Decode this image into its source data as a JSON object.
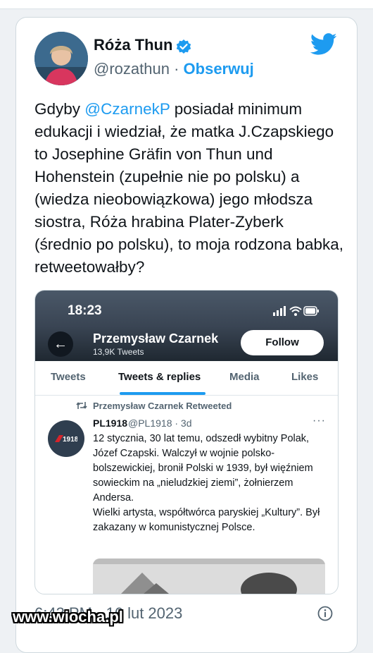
{
  "tweet": {
    "author_name": "Róża Thun",
    "handle": "@rozathun",
    "separator": "·",
    "follow_link": "Obserwuj",
    "text_before_mention": "Gdyby ",
    "mention": "@CzarnekP",
    "text_after_mention": " posiadał minimum edukacji i wiedział, że matka J.Czapskiego to Josephine Gräfin von Thun und Hohenstein (zupełnie nie po polsku) a (wiedza nieobowiązkowa) jego młodsza siostra, Róża hrabina Plater-Zyberk (średnio po polsku), to moja rodzona babka, retweetowałby?",
    "timestamp": "6:43 PM · 16 lut 2023"
  },
  "embedded": {
    "status_time": "18:23",
    "profile_name": "Przemysław Czarnek",
    "tweet_count": "13,9K Tweets",
    "follow_button": "Follow",
    "back_symbol": "←",
    "tabs": [
      "Tweets",
      "Tweets & replies",
      "Media",
      "Likes"
    ],
    "active_tab": "Tweets & replies",
    "retweeted_by": "Przemysław Czarnek Retweeted",
    "post_author": "PL1918",
    "post_meta": "@PL1918 · 3d",
    "post_more": "···",
    "post_text": "12 stycznia, 30 lat temu, odszedł wybitny Polak, Józef Czapski. Walczył w wojnie polsko-bolszewickiej, bronił Polski w 1939, był więźniem sowieckim na „nieludzkiej ziemi”, żołnierzem Andersa.\nWielki artysta, współtwórca paryskiej „Kultury”. Był zakazany w komunistycznej Polsce.",
    "logo_text": "1918"
  },
  "watermark": "www.wiocha.pl",
  "colors": {
    "accent": "#1d9bf0",
    "text": "#0f1419",
    "muted": "#536471",
    "background": "#eef1f4"
  },
  "icons": {
    "verified": "verified-badge-icon",
    "brand": "twitter-bird-icon",
    "info": "info-icon",
    "retweet": "retweet-icon"
  }
}
